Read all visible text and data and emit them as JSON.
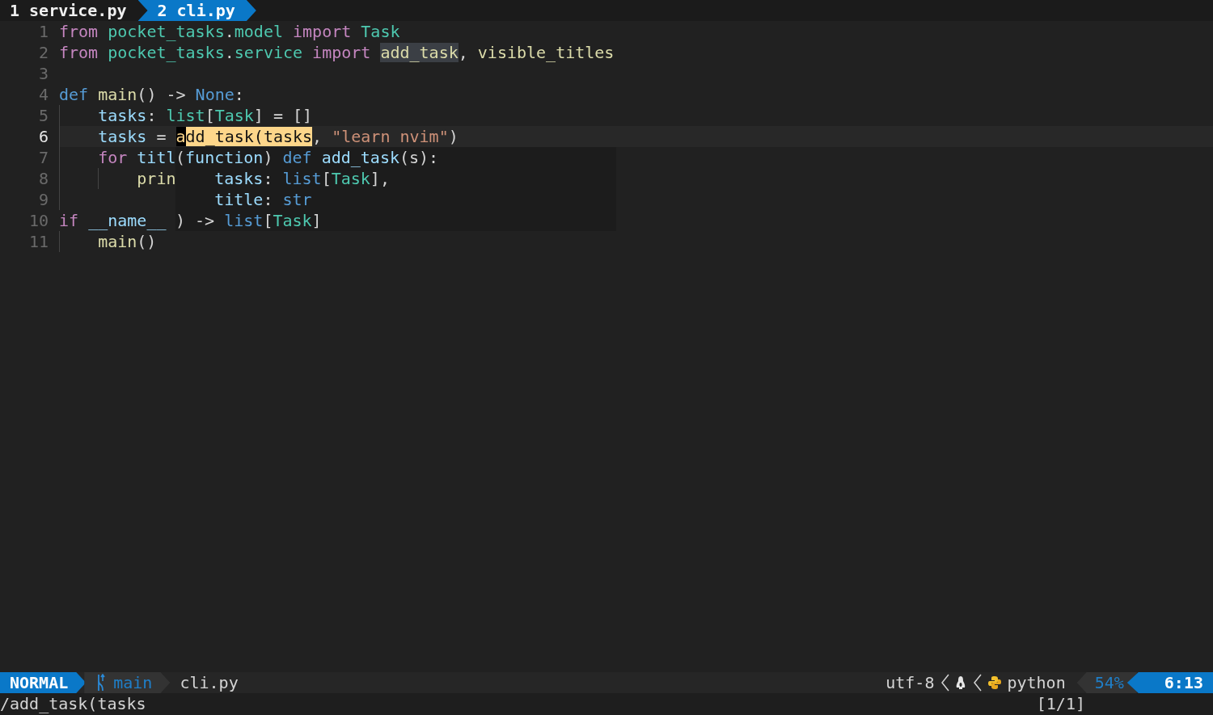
{
  "tabs": [
    {
      "number": "1",
      "label": "service.py",
      "selected": false
    },
    {
      "number": "2",
      "label": "cli.py",
      "selected": true
    }
  ],
  "editor": {
    "lines": [
      {
        "number": "1",
        "current": false,
        "tokens": [
          {
            "kind": "keyword",
            "text": "from"
          },
          {
            "kind": "module",
            "text": " pocket_tasks"
          },
          {
            "kind": "plain",
            "text": "."
          },
          {
            "kind": "module",
            "text": "model"
          },
          {
            "kind": "keyword",
            "text": " import"
          },
          {
            "kind": "type",
            "text": " Task"
          }
        ]
      },
      {
        "number": "2",
        "current": false,
        "tokens": [
          {
            "kind": "keyword",
            "text": "from"
          },
          {
            "kind": "module",
            "text": " pocket_tasks"
          },
          {
            "kind": "plain",
            "text": "."
          },
          {
            "kind": "module",
            "text": "service"
          },
          {
            "kind": "keyword",
            "text": " import "
          },
          {
            "kind": "function",
            "text": "add_task",
            "reference": true
          },
          {
            "kind": "plain",
            "text": ","
          },
          {
            "kind": "function",
            "text": " visible_titles"
          }
        ]
      },
      {
        "number": "3",
        "current": false
      },
      {
        "number": "4",
        "current": false,
        "tokens": [
          {
            "kind": "builtin",
            "text": "def"
          },
          {
            "kind": "function",
            "text": " main"
          },
          {
            "kind": "plain",
            "text": "() ->"
          },
          {
            "kind": "builtin",
            "text": " None"
          },
          {
            "kind": "plain",
            "text": ":"
          }
        ]
      },
      {
        "number": "5",
        "current": false,
        "guides": [
          true
        ],
        "tokens": [
          {
            "kind": "variable",
            "text": "tasks"
          },
          {
            "kind": "plain",
            "text": ":"
          },
          {
            "kind": "type",
            "text": " list"
          },
          {
            "kind": "plain",
            "text": "["
          },
          {
            "kind": "type",
            "text": "Task"
          },
          {
            "kind": "plain",
            "text": "] = []"
          }
        ]
      },
      {
        "number": "6",
        "current": true,
        "guides": [
          true
        ],
        "tokens": [
          {
            "kind": "variable",
            "text": "tasks"
          },
          {
            "kind": "plain",
            "text": " = "
          },
          {
            "kind": "function",
            "text": "a",
            "cursor": true
          },
          {
            "kind": "function",
            "text": "dd_task(tasks",
            "search_match": true
          },
          {
            "kind": "plain",
            "text": ","
          },
          {
            "kind": "string",
            "text": " \"learn nvim\""
          },
          {
            "kind": "plain",
            "text": ")"
          }
        ]
      },
      {
        "number": "7",
        "current": false,
        "guides": [
          true
        ],
        "tokens": [
          {
            "kind": "keyword",
            "text": "for"
          },
          {
            "kind": "variable",
            "text": " titl"
          }
        ]
      },
      {
        "number": "8",
        "current": false,
        "guides": [
          true,
          true
        ],
        "tokens": [
          {
            "kind": "function",
            "text": "prin"
          }
        ]
      },
      {
        "number": "9",
        "current": false,
        "guides": [
          true
        ]
      },
      {
        "number": "10",
        "current": false,
        "tokens": [
          {
            "kind": "keyword",
            "text": "if"
          },
          {
            "kind": "variable",
            "text": " __name__"
          }
        ]
      },
      {
        "number": "11",
        "current": false,
        "guides": [
          true
        ],
        "tokens": [
          {
            "kind": "function",
            "text": "main"
          },
          {
            "kind": "plain",
            "text": "()"
          }
        ]
      }
    ]
  },
  "signature_popup": {
    "lines": [
      [
        {
          "kind": "plain",
          "text": "("
        },
        {
          "kind": "variable",
          "text": "function"
        },
        {
          "kind": "plain",
          "text": ")"
        },
        {
          "kind": "builtin",
          "text": " def"
        },
        {
          "kind": "variable",
          "text": " add_task"
        },
        {
          "kind": "plain",
          "text": "(s):"
        }
      ],
      [
        {
          "kind": "variable",
          "text": "    tasks"
        },
        {
          "kind": "plain",
          "text": ":"
        },
        {
          "kind": "builtin",
          "text": " list"
        },
        {
          "kind": "plain",
          "text": "["
        },
        {
          "kind": "type",
          "text": "Task"
        },
        {
          "kind": "plain",
          "text": "],"
        }
      ],
      [
        {
          "kind": "variable",
          "text": "    title"
        },
        {
          "kind": "plain",
          "text": ":"
        },
        {
          "kind": "builtin",
          "text": " str"
        }
      ],
      [
        {
          "kind": "plain",
          "text": ") ->"
        },
        {
          "kind": "builtin",
          "text": " list"
        },
        {
          "kind": "plain",
          "text": "["
        },
        {
          "kind": "type",
          "text": "Task"
        },
        {
          "kind": "plain",
          "text": "]"
        }
      ]
    ]
  },
  "status_bar": {
    "mode": "NORMAL",
    "branch": "main",
    "file": "cli.py",
    "encoding": "utf-8",
    "filetype": "python",
    "percent": "54%",
    "position": "6:13"
  },
  "command_line": {
    "text": "/add_task(tasks",
    "search_count": "[1/1]"
  }
}
